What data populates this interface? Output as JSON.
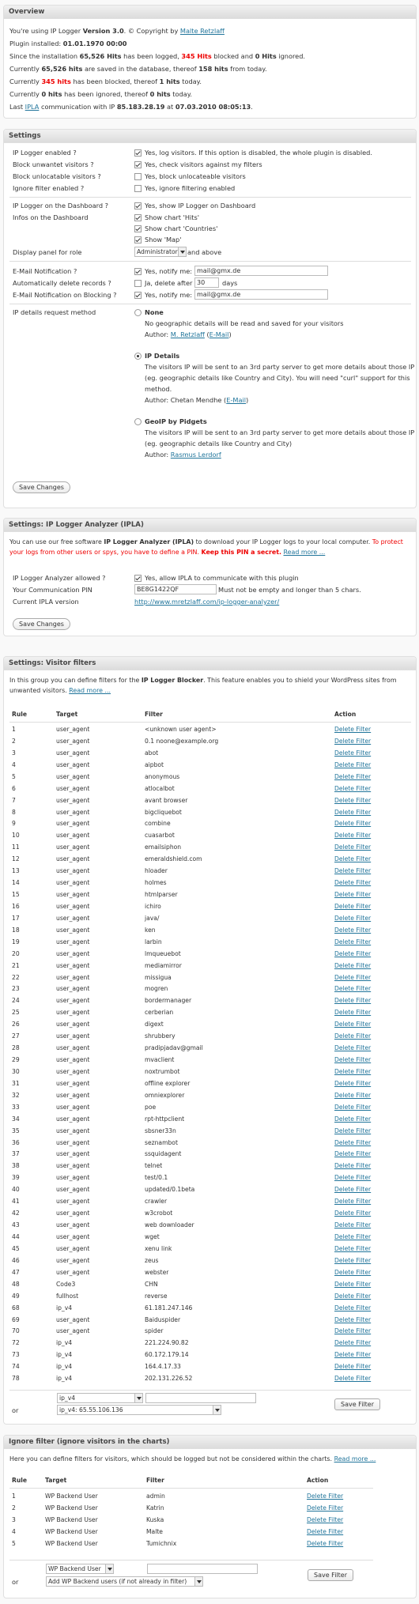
{
  "overview": {
    "title": "Overview",
    "l1_a": "You're using IP Logger ",
    "l1_b": "Version 3.0",
    "l1_c": ". © Copyright by ",
    "l1_link": "Malte Retzlaff",
    "l2_a": "Plugin installed: ",
    "l2_b": "01.01.1970 00:00",
    "l3_a": "Since the installation ",
    "l3_b": "65,526 Hits",
    "l3_c": " has been logged, ",
    "l3_d": "345 Hits",
    "l3_e": " blocked and ",
    "l3_f": "0 Hits",
    "l3_g": " ignored.",
    "l4_a": "Currently ",
    "l4_b": "65,526 hits",
    "l4_c": " are saved in the database, thereof ",
    "l4_d": "158 hits",
    "l4_e": " from today.",
    "l5_a": "Currently ",
    "l5_b": "345 hits",
    "l5_c": " has been blocked, thereof ",
    "l5_d": "1 hits",
    "l5_e": " today.",
    "l6_a": "Currently ",
    "l6_b": "0 hits",
    "l6_c": " has been ignored, thereof ",
    "l6_d": "0 hits",
    "l6_e": " today.",
    "l7_a": "Last ",
    "l7_link": "IPLA",
    "l7_b": " communication with IP ",
    "l7_c": "85.183.28.19",
    "l7_d": " at ",
    "l7_e": "07.03.2010 08:05:13",
    "l7_f": "."
  },
  "settings": {
    "title": "Settings",
    "enabled_label": "IP Logger enabled ?",
    "enabled_text": "Yes, log visitors. If this option is disabled, the whole plugin is disabled.",
    "block_label": "Block unwantet visitors ?",
    "block_text": "Yes, check visitors against my filters",
    "unloc_label": "Block unlocatable visitors ?",
    "unloc_text": "Yes, block unlocateable visitors",
    "ignore_label": "Ignore filter enabled ?",
    "ignore_text": "Yes, ignore filtering enabled",
    "dash_label": "IP Logger on the Dashboard ?",
    "dash_text": "Yes, show IP Logger on Dashboard",
    "infos_label": "Infos on the Dashboard",
    "hits_text": "Show chart 'Hits'",
    "countries_text": "Show chart 'Countries'",
    "map_text": "Show 'Map'",
    "role_label": "Display panel for role",
    "role_value": "Administrator",
    "role_after": "and above",
    "email_label": "E-Mail Notification ?",
    "email_text": "Yes, notify me:",
    "email_value": "mail@gmx.de",
    "delete_label": "Automatically delete records ?",
    "delete_text": "Ja, delete after",
    "delete_value": "30",
    "delete_unit": "days",
    "emailblock_label": "E-Mail Notification on Blocking ?",
    "emailblock_text": "Yes, notify me:",
    "emailblock_value": "mail@gmx.de",
    "method_label": "IP details request method",
    "none_title": "None",
    "none_desc": "No geographic details will be read and saved for your visitors",
    "none_author_a": "Author: ",
    "none_author_link": "M. Retzlaff",
    "none_author_b": " (",
    "none_author_email": "E-Mail",
    "none_author_c": ")",
    "ipd_title": "IP Details",
    "ipd_desc1": "The visitors IP will be sent to an 3rd party server to get more details about those IP",
    "ipd_desc2": "(eg. geographic details like Country and City). You will need \"curl\" support for this",
    "ipd_desc3": "method.",
    "ipd_author_a": "Author: Chetan Mendhe (",
    "ipd_author_email": "E-Mail",
    "ipd_author_b": ")",
    "geo_title": "GeoIP by Pidgets",
    "geo_desc1": "The visitors IP will be sent to an 3rd party server to get more details about those IP",
    "geo_desc2": "(eg. geographic details like Country and City)",
    "geo_author_a": "Author: ",
    "geo_author_link": "Rasmus Lerdorf",
    "save": "Save Changes"
  },
  "ipla": {
    "title": "Settings: IP Logger Analyzer (IPLA)",
    "intro1_a": "You can use our free software ",
    "intro1_b": "IP Logger Analyzer (IPLA)",
    "intro1_c": " to download your IP Logger logs to your local computer. ",
    "intro1_d": "To protect",
    "intro2_a": "your logs from other users or spys, you have to define a PIN. ",
    "intro2_b": "Keep this PIN a secret.",
    "intro2_c": " ",
    "intro2_link": "Read more ...",
    "allowed_label": "IP Logger Analyzer allowed ?",
    "allowed_text": "Yes, allow IPLA to communicate with this plugin",
    "pin_label": "Your Communication PIN",
    "pin_value": "BE8G1422QF",
    "pin_hint": "Must not be empty and longer than 5 chars.",
    "version_label": "Current IPLA version",
    "version_link": "http://www.mretzlaff.com/ip-logger-analyzer/",
    "save": "Save Changes"
  },
  "filters": {
    "title": "Settings: Visitor filters",
    "intro1_a": "In this group you can define filters for the ",
    "intro1_b": "IP Logger Blocker",
    "intro1_c": ". This feature enables you to shield your WordPress sites from",
    "intro2_a": "unwanted visitors. ",
    "intro2_link": "Read more ...",
    "headers": [
      "Rule",
      "Target",
      "Filter",
      "Action"
    ],
    "action_label": "Delete Filter",
    "rows": [
      [
        "1",
        "user_agent",
        "<unknown user agent>"
      ],
      [
        "2",
        "user_agent",
        "0.1 noone@example.org"
      ],
      [
        "3",
        "user_agent",
        "abot"
      ],
      [
        "4",
        "user_agent",
        "aipbot"
      ],
      [
        "5",
        "user_agent",
        "anonymous"
      ],
      [
        "6",
        "user_agent",
        "atlocalbot"
      ],
      [
        "7",
        "user_agent",
        "avant browser"
      ],
      [
        "8",
        "user_agent",
        "bigcliquebot"
      ],
      [
        "9",
        "user_agent",
        "combine"
      ],
      [
        "10",
        "user_agent",
        "cuasarbot"
      ],
      [
        "11",
        "user_agent",
        "emailsiphon"
      ],
      [
        "12",
        "user_agent",
        "emeraldshield.com"
      ],
      [
        "13",
        "user_agent",
        "hloader"
      ],
      [
        "14",
        "user_agent",
        "holmes"
      ],
      [
        "15",
        "user_agent",
        "htmlparser"
      ],
      [
        "16",
        "user_agent",
        "ichiro"
      ],
      [
        "17",
        "user_agent",
        "java/"
      ],
      [
        "18",
        "user_agent",
        "ken"
      ],
      [
        "19",
        "user_agent",
        "larbin"
      ],
      [
        "20",
        "user_agent",
        "lmqueuebot"
      ],
      [
        "21",
        "user_agent",
        "mediamirror"
      ],
      [
        "22",
        "user_agent",
        "missigua"
      ],
      [
        "23",
        "user_agent",
        "mogren"
      ],
      [
        "24",
        "user_agent",
        "bordermanager"
      ],
      [
        "25",
        "user_agent",
        "cerberian"
      ],
      [
        "26",
        "user_agent",
        "digext"
      ],
      [
        "27",
        "user_agent",
        "shrubbery"
      ],
      [
        "28",
        "user_agent",
        "pradipjadav@gmail"
      ],
      [
        "29",
        "user_agent",
        "mvaclient"
      ],
      [
        "30",
        "user_agent",
        "noxtrumbot"
      ],
      [
        "31",
        "user_agent",
        "offline explorer"
      ],
      [
        "32",
        "user_agent",
        "omniexplorer"
      ],
      [
        "33",
        "user_agent",
        "poe"
      ],
      [
        "34",
        "user_agent",
        "rpt-httpclient"
      ],
      [
        "35",
        "user_agent",
        "sbsner33n"
      ],
      [
        "36",
        "user_agent",
        "seznambot"
      ],
      [
        "37",
        "user_agent",
        "ssquidagent"
      ],
      [
        "38",
        "user_agent",
        "telnet"
      ],
      [
        "39",
        "user_agent",
        "test/0.1"
      ],
      [
        "40",
        "user_agent",
        "updated/0.1beta"
      ],
      [
        "41",
        "user_agent",
        "crawler"
      ],
      [
        "42",
        "user_agent",
        "w3crobot"
      ],
      [
        "43",
        "user_agent",
        "web downloader"
      ],
      [
        "44",
        "user_agent",
        "wget"
      ],
      [
        "45",
        "user_agent",
        "xenu link"
      ],
      [
        "46",
        "user_agent",
        "zeus"
      ],
      [
        "47",
        "user_agent",
        "webster"
      ],
      [
        "48",
        "Code3",
        "CHN"
      ],
      [
        "49",
        "fullhost",
        "reverse"
      ],
      [
        "68",
        "ip_v4",
        "61.181.247.146"
      ],
      [
        "69",
        "user_agent",
        "Baiduspider"
      ],
      [
        "70",
        "user_agent",
        "spider"
      ],
      [
        "72",
        "ip_v4",
        "221.224.90.82"
      ],
      [
        "73",
        "ip_v4",
        "60.172.179.14"
      ],
      [
        "74",
        "ip_v4",
        "164.4.17.33"
      ],
      [
        "78",
        "ip_v4",
        "202.131.226.52"
      ]
    ],
    "new_target": "ip_v4",
    "or_label": "or",
    "preset_value": "ip_v4: 65.55.106.136",
    "save": "Save Filter"
  },
  "ignore": {
    "title": "Ignore filter (ignore visitors in the charts)",
    "intro_a": "Here you can define filters for visitors, which should be logged but not be considered within the charts. ",
    "intro_link": "Read more ...",
    "headers": [
      "Rule",
      "Target",
      "Filter",
      "Action"
    ],
    "action_label": "Delete Filter",
    "rows": [
      [
        "1",
        "WP Backend User",
        "admin"
      ],
      [
        "2",
        "WP Backend User",
        "Katrin"
      ],
      [
        "3",
        "WP Backend User",
        "Kuska"
      ],
      [
        "4",
        "WP Backend User",
        "Malte"
      ],
      [
        "5",
        "WP Backend User",
        "Tumichnix"
      ]
    ],
    "new_target": "WP Backend User",
    "or_label": "or",
    "preset_value": "Add WP Backend users (if not already in filter)",
    "save": "Save Filter"
  }
}
